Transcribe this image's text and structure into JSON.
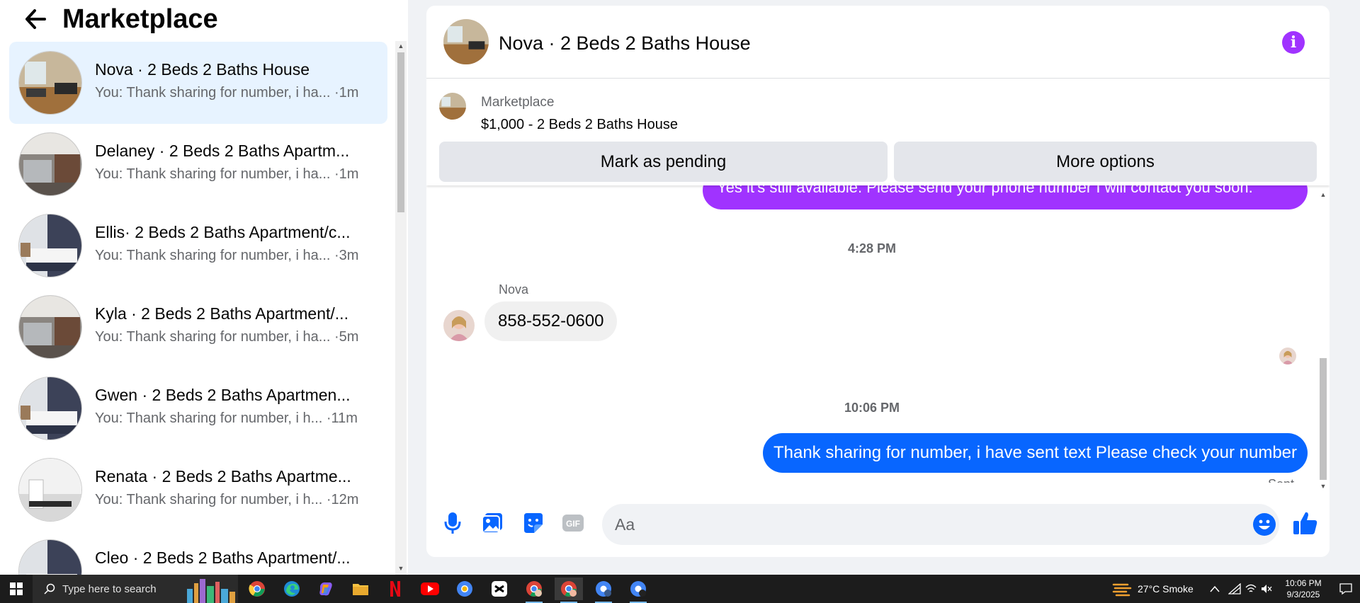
{
  "left_panel": {
    "title": "Marketplace",
    "conversations": [
      {
        "title": "Nova · 2 Beds 2 Baths House",
        "preview": "You: Thank sharing for number, i ha... ·1m",
        "active": true
      },
      {
        "title": "Delaney · 2 Beds 2 Baths Apartm...",
        "preview": "You: Thank sharing for number, i ha... ·1m",
        "active": false
      },
      {
        "title": "Ellis· 2 Beds 2 Baths Apartment/c...",
        "preview": "You: Thank sharing for number, i ha... ·3m",
        "active": false
      },
      {
        "title": "Kyla · 2 Beds 2 Baths Apartment/...",
        "preview": "You: Thank sharing for number, i ha... ·5m",
        "active": false
      },
      {
        "title": "Gwen · 2 Beds 2 Baths Apartmen...",
        "preview": "You: Thank sharing for number, i h... ·11m",
        "active": false
      },
      {
        "title": "Renata · 2 Beds 2 Baths Apartme...",
        "preview": "You: Thank sharing for number, i h... ·12m",
        "active": false
      },
      {
        "title": "Cleo · 2 Beds 2 Baths Apartment/...",
        "preview": "",
        "active": false
      }
    ]
  },
  "chat": {
    "title": "Nova · 2 Beds 2 Baths House",
    "listing_label": "Marketplace",
    "listing_price": "$1,000 - 2 Beds 2 Baths House",
    "mark_pending_label": "Mark as pending",
    "more_options_label": "More options",
    "messages": {
      "prev_sent": "Yes it's still available. Please send your phone number I will contact you soon.",
      "time1": "4:28 PM",
      "sender_name": "Nova",
      "received": "858-552-0600",
      "time2": "10:06 PM",
      "sent": "Thank sharing for number, i have sent text Please check your number",
      "sent_status": "Sent"
    },
    "composer_placeholder": "Aa"
  },
  "colors": {
    "accent_blue": "#0866ff",
    "accent_purple": "#a033ff",
    "active_bg": "#e7f3ff"
  },
  "taskbar": {
    "search_placeholder": "Type here to search",
    "weather": "27°C  Smoke",
    "time": "10:06 PM",
    "date": "9/3/2025"
  }
}
